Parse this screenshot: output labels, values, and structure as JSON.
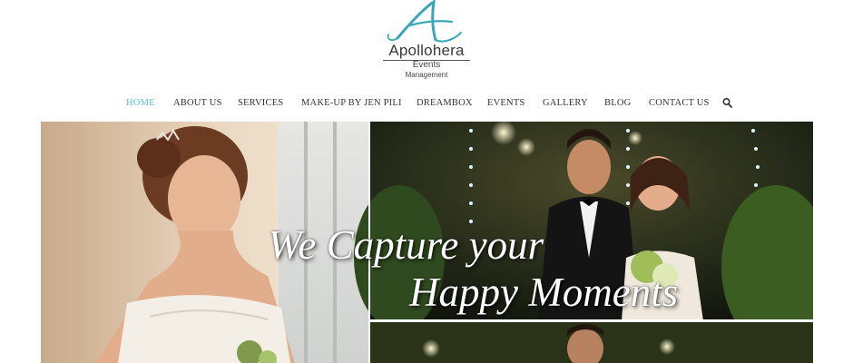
{
  "brand": {
    "name": "Apollohera",
    "line2": "Events",
    "line3": "Management",
    "accent": "#3aa7b8"
  },
  "nav": {
    "items": [
      {
        "label": "HOME",
        "active": true
      },
      {
        "label": "ABOUT US"
      },
      {
        "label": "SERVICES"
      },
      {
        "label": "MAKE-UP BY JEN PILI"
      },
      {
        "label": "DREAMBOX"
      },
      {
        "label": "EVENTS"
      },
      {
        "label": "GALLERY"
      },
      {
        "label": "BLOG"
      },
      {
        "label": "CONTACT US"
      }
    ],
    "search_icon": "search-icon",
    "active_color": "#5bbcd0",
    "text_color": "#333333"
  },
  "hero": {
    "tagline_line1": "We Capture your",
    "tagline_line2": "Happy Moments"
  }
}
